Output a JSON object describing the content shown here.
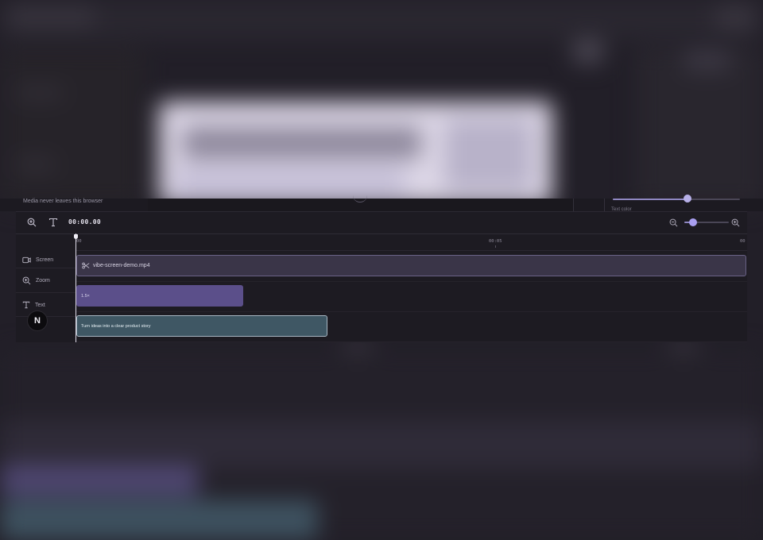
{
  "preview": {
    "note": "Media never leaves this browser",
    "right_panel_label": "Text color",
    "slider_value": 0.59
  },
  "toolbar": {
    "zoom_tool_icon": "zoom-in-icon",
    "text_tool_icon": "text-icon",
    "timecode": "00:00.00",
    "timeline_zoom_value": 0.2
  },
  "ruler": {
    "ticks": [
      "00",
      "00:05",
      "00"
    ]
  },
  "tracks": [
    {
      "label": "Screen",
      "icon": "video-icon"
    },
    {
      "label": "Zoom",
      "icon": "zoom-in-icon"
    },
    {
      "label": "Text",
      "icon": "text-icon"
    }
  ],
  "clips": {
    "screen": {
      "name": "vibe-screen-demo.mp4",
      "icon": "scissors-icon"
    },
    "zoom": {
      "label": "1.5×"
    },
    "text": {
      "label": "Turn ideas into a clear product story"
    }
  },
  "badge": {
    "letter": "N"
  },
  "colors": {
    "accent": "#a99ff0",
    "zoom_clip": "#5b4f8a",
    "text_clip": "#3f5764",
    "screen_clip": "#3a3548"
  }
}
